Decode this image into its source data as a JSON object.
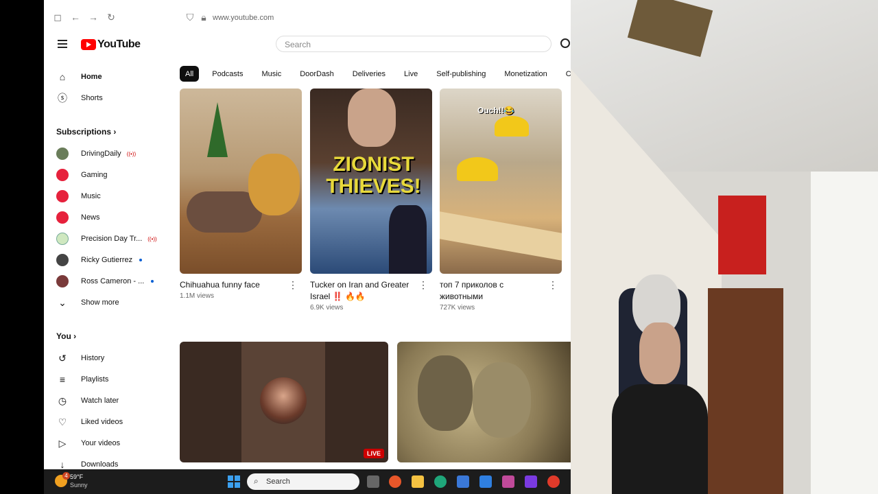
{
  "browser": {
    "url": "www.youtube.com"
  },
  "header": {
    "logo_text": "YouTube",
    "search_placeholder": "Search"
  },
  "sidebar": {
    "main": [
      {
        "label": "Home",
        "icon": "home-icon"
      },
      {
        "label": "Shorts",
        "icon": "shorts-icon"
      }
    ],
    "subscriptions_title": "Subscriptions",
    "subscriptions": [
      {
        "label": "DrivingDaily",
        "badge": "live"
      },
      {
        "label": "Gaming",
        "badge": ""
      },
      {
        "label": "Music",
        "badge": ""
      },
      {
        "label": "News",
        "badge": ""
      },
      {
        "label": "Precision Day Tr...",
        "badge": "live"
      },
      {
        "label": "Ricky Gutierrez",
        "badge": "new"
      },
      {
        "label": "Ross Cameron - ...",
        "badge": "new"
      }
    ],
    "show_more": "Show more",
    "you_title": "You",
    "you_items": [
      {
        "label": "History",
        "icon": "history-icon"
      },
      {
        "label": "Playlists",
        "icon": "playlists-icon"
      },
      {
        "label": "Watch later",
        "icon": "clock-icon"
      },
      {
        "label": "Liked videos",
        "icon": "thumb-up-icon"
      },
      {
        "label": "Your videos",
        "icon": "play-icon"
      },
      {
        "label": "Downloads",
        "icon": "download-icon"
      }
    ]
  },
  "chips": [
    "All",
    "Podcasts",
    "Music",
    "DoorDash",
    "Deliveries",
    "Live",
    "Self-publishing",
    "Monetization",
    "Co"
  ],
  "videos": [
    {
      "title": "Chihuahua funny face",
      "views": "1.1M views"
    },
    {
      "title": "Tucker on Iran and Greater Israel ‼️ 🔥🔥",
      "views": "6.9K views",
      "thumb_text": "ZIONIST THIEVES!"
    },
    {
      "title": "топ 7 приколов с животными",
      "views": "727K views",
      "thumb_text": "Ouch!!😂"
    }
  ],
  "live_badge": "LIVE",
  "taskbar": {
    "temp": "59°F",
    "weather": "Sunny",
    "search": "Search",
    "notif_count": "4"
  },
  "colors": {
    "yt_red": "#ff0000",
    "chip_active": "#0f0f0f",
    "taskbar": "#1c1c1c"
  }
}
